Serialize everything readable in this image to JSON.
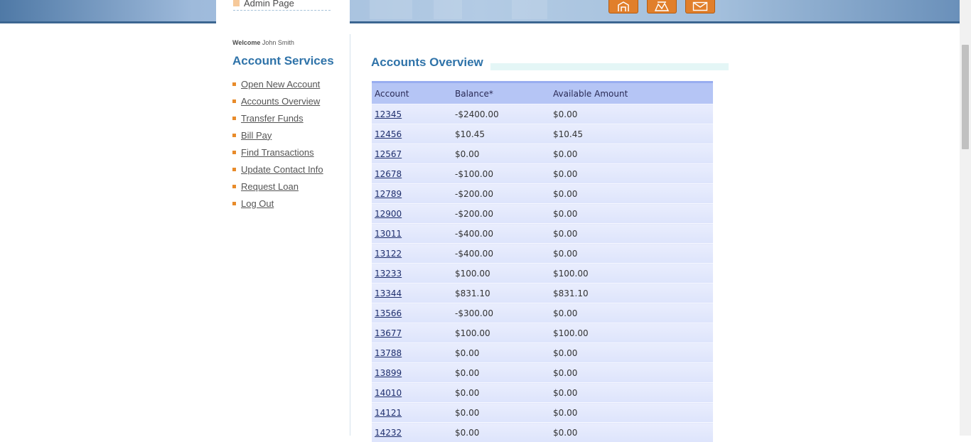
{
  "header": {
    "admin_label": "Admin Page",
    "buttons": [
      {
        "name": "home-icon"
      },
      {
        "name": "about-icon"
      },
      {
        "name": "contact-icon"
      }
    ]
  },
  "sidebar": {
    "welcome_label": "Welcome",
    "user_name": "John Smith",
    "title": "Account Services",
    "items": [
      {
        "label": "Open New Account"
      },
      {
        "label": "Accounts Overview"
      },
      {
        "label": "Transfer Funds"
      },
      {
        "label": "Bill Pay"
      },
      {
        "label": "Find Transactions"
      },
      {
        "label": "Update Contact Info"
      },
      {
        "label": "Request Loan"
      },
      {
        "label": "Log Out"
      }
    ]
  },
  "main": {
    "title": "Accounts Overview",
    "columns": [
      "Account",
      "Balance*",
      "Available Amount"
    ],
    "rows": [
      {
        "account": "12345",
        "balance": "-$2400.00",
        "available": "$0.00"
      },
      {
        "account": "12456",
        "balance": "$10.45",
        "available": "$10.45"
      },
      {
        "account": "12567",
        "balance": "$0.00",
        "available": "$0.00"
      },
      {
        "account": "12678",
        "balance": "-$100.00",
        "available": "$0.00"
      },
      {
        "account": "12789",
        "balance": "-$200.00",
        "available": "$0.00"
      },
      {
        "account": "12900",
        "balance": "-$200.00",
        "available": "$0.00"
      },
      {
        "account": "13011",
        "balance": "-$400.00",
        "available": "$0.00"
      },
      {
        "account": "13122",
        "balance": "-$400.00",
        "available": "$0.00"
      },
      {
        "account": "13233",
        "balance": "$100.00",
        "available": "$100.00"
      },
      {
        "account": "13344",
        "balance": "$831.10",
        "available": "$831.10"
      },
      {
        "account": "13566",
        "balance": "-$300.00",
        "available": "$0.00"
      },
      {
        "account": "13677",
        "balance": "$100.00",
        "available": "$100.00"
      },
      {
        "account": "13788",
        "balance": "$0.00",
        "available": "$0.00"
      },
      {
        "account": "13899",
        "balance": "$0.00",
        "available": "$0.00"
      },
      {
        "account": "14010",
        "balance": "$0.00",
        "available": "$0.00"
      },
      {
        "account": "14121",
        "balance": "$0.00",
        "available": "$0.00"
      },
      {
        "account": "14232",
        "balance": "$0.00",
        "available": "$0.00"
      }
    ]
  },
  "colors": {
    "accent_blue": "#2f73a9",
    "bullet_orange": "#e88b2a",
    "header_button": "#e17f2b",
    "table_header": "#b5c5f5",
    "table_row": "#e3e8fc"
  }
}
